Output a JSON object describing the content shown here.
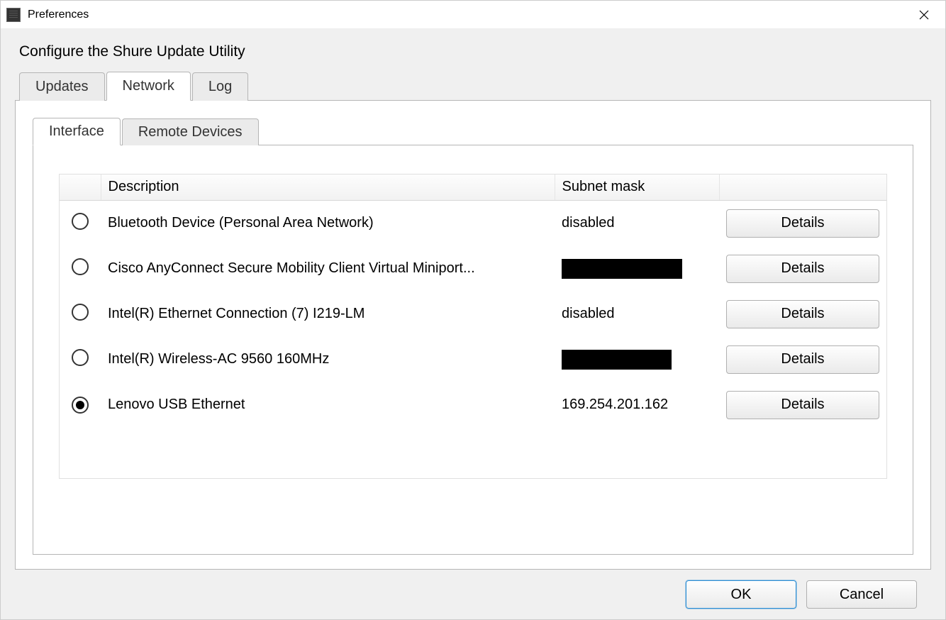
{
  "window": {
    "title": "Preferences"
  },
  "heading": "Configure the Shure Update Utility",
  "outer_tabs": {
    "updates": "Updates",
    "network": "Network",
    "log": "Log",
    "active": "network"
  },
  "inner_tabs": {
    "interface": "Interface",
    "remote_devices": "Remote Devices",
    "active": "interface"
  },
  "columns": {
    "radio": "",
    "description": "Description",
    "subnet_mask": "Subnet mask",
    "action": ""
  },
  "details_label": "Details",
  "interfaces": [
    {
      "selected": false,
      "description": "Bluetooth Device (Personal Area Network)",
      "subnet_mask": "disabled",
      "redacted": false
    },
    {
      "selected": false,
      "description": "Cisco AnyConnect Secure Mobility Client Virtual Miniport...",
      "subnet_mask": "",
      "redacted": true
    },
    {
      "selected": false,
      "description": "Intel(R) Ethernet Connection (7) I219-LM",
      "subnet_mask": "disabled",
      "redacted": false
    },
    {
      "selected": false,
      "description": "Intel(R) Wireless-AC 9560 160MHz",
      "subnet_mask": "",
      "redacted": true
    },
    {
      "selected": true,
      "description": "Lenovo USB Ethernet",
      "subnet_mask": "169.254.201.162",
      "redacted": false
    }
  ],
  "buttons": {
    "ok": "OK",
    "cancel": "Cancel"
  }
}
